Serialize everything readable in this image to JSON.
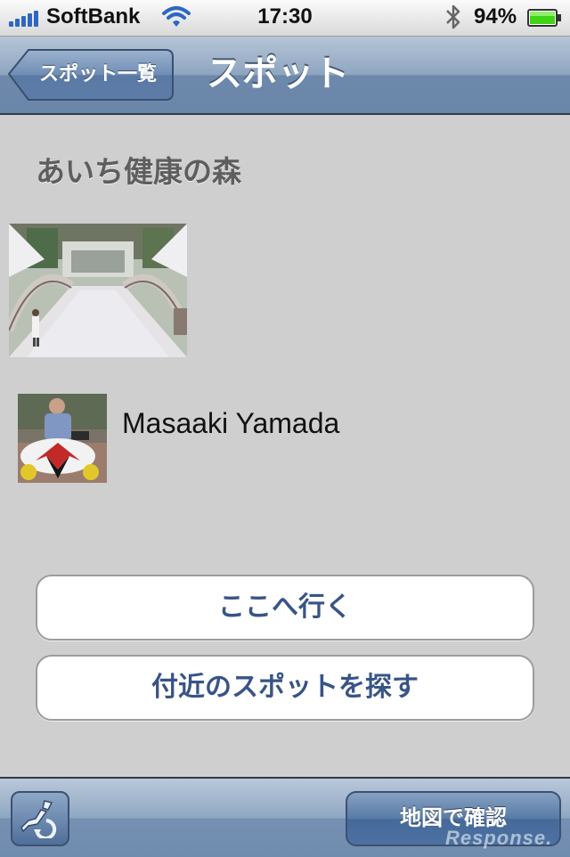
{
  "status_bar": {
    "carrier": "SoftBank",
    "time": "17:30",
    "battery_percent": "94%",
    "icons": [
      "signal-icon",
      "wifi-icon",
      "bluetooth-icon",
      "battery-icon"
    ]
  },
  "nav": {
    "back_label": "スポット一覧",
    "title": "スポット"
  },
  "spot": {
    "name": "あいち健康の森",
    "user_name": "Masaaki Yamada"
  },
  "actions": {
    "go_label": "ここへ行く",
    "nearby_label": "付近のスポットを探す"
  },
  "toolbar": {
    "map_label": "地図で確認",
    "left_icon": "japan-map-refresh-icon"
  },
  "watermark": "Response.",
  "colors": {
    "nav_blue": "#6d88aa",
    "button_text": "#385488",
    "battery_green": "#3fd416",
    "signal_blue": "#2d67c4"
  }
}
